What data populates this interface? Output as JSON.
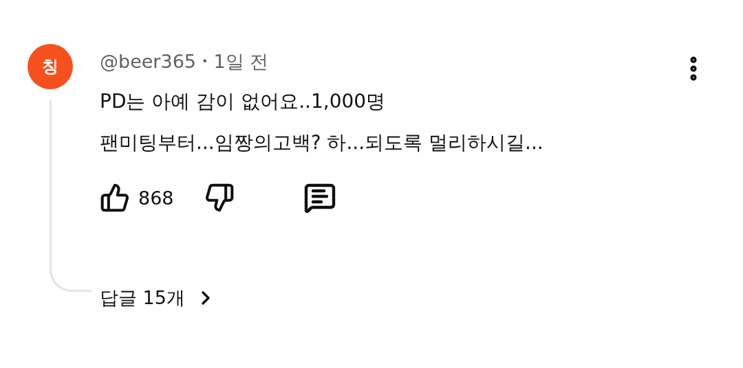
{
  "comment": {
    "avatar_letter": "칭",
    "author": "@beer365",
    "separator": "•",
    "time": "1일 전",
    "lines": [
      "PD는 아예 감이 없어요..1,000명",
      "팬미팅부터...임짱의고백? 하...되도록 멀리하시길..."
    ],
    "likes": "868",
    "replies": "답글 15개"
  }
}
